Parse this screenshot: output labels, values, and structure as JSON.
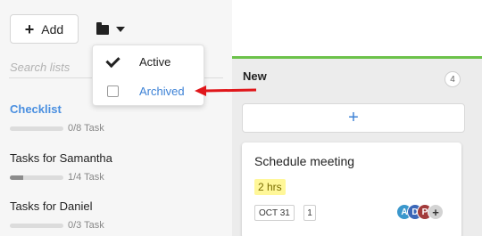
{
  "toolbar": {
    "add_label": "Add",
    "add_icon": "+"
  },
  "search": {
    "placeholder": "Search lists"
  },
  "lists": [
    {
      "title": "Checklist",
      "progress_text": "0/8 Task",
      "progress": 0.0,
      "active": true
    },
    {
      "title": "Tasks for Samantha",
      "progress_text": "1/4 Task",
      "progress": 0.25,
      "active": false
    },
    {
      "title": "Tasks for Daniel",
      "progress_text": "0/3 Task",
      "progress": 0.0,
      "active": false
    }
  ],
  "filter_menu": {
    "items": [
      {
        "label": "Active",
        "checked": true
      },
      {
        "label": "Archived",
        "checked": false
      }
    ]
  },
  "board": {
    "column_title": "New",
    "count": "4",
    "add_card_icon": "+",
    "accent_color": "#6cc24a",
    "card": {
      "title": "Schedule meeting",
      "hours": "2 hrs",
      "date": "OCT 31",
      "number": "1",
      "avatars": [
        "A",
        "D",
        "P"
      ],
      "more": "+"
    }
  },
  "colors": {
    "link_blue": "#3d82d6",
    "annotation_red": "#e0171b"
  }
}
